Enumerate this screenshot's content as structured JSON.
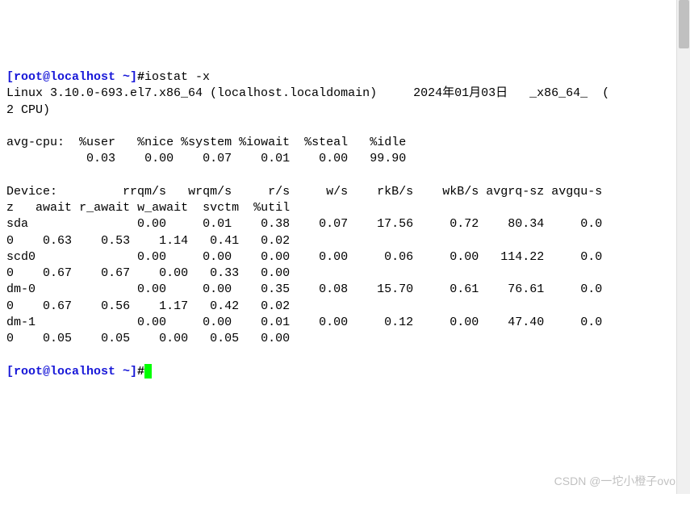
{
  "prompt1": {
    "user_host": "[root@localhost ~]",
    "hash": "#",
    "command": "iostat -x"
  },
  "header": {
    "kernel": "Linux 3.10.0-693.el7.x86_64 (localhost.localdomain)",
    "date": "2024年01月03日",
    "arch": "_x86_64_",
    "cpu_wrap_open": "(",
    "cpu_wrap_close": "2 CPU)"
  },
  "avg_cpu": {
    "label": "avg-cpu:",
    "cols": {
      "user": "%user",
      "nice": "%nice",
      "system": "%system",
      "iowait": "%iowait",
      "steal": "%steal",
      "idle": "%idle"
    },
    "vals": {
      "user": "0.03",
      "nice": "0.00",
      "system": "0.07",
      "iowait": "0.01",
      "steal": "0.00",
      "idle": "99.90"
    }
  },
  "dev_header": {
    "label": "Device:",
    "l1": {
      "rrqm": "rrqm/s",
      "wrqm": "wrqm/s",
      "rs": "r/s",
      "ws": "w/s",
      "rkb": "rkB/s",
      "wkb": "wkB/s",
      "avgrq": "avgrq-sz",
      "avgqu": "avgqu-s"
    },
    "l2": {
      "z": "z",
      "await": "await",
      "r_await": "r_await",
      "w_await": "w_await",
      "svctm": "svctm",
      "util": "%util"
    }
  },
  "devices": {
    "sda": {
      "name": "sda",
      "l1": {
        "rrqm": "0.00",
        "wrqm": "0.01",
        "rs": "0.38",
        "ws": "0.07",
        "rkb": "17.56",
        "wkb": "0.72",
        "avgrq": "80.34",
        "avgqu": "0.0"
      },
      "l2": {
        "z": "0",
        "await": "0.63",
        "r_await": "0.53",
        "w_await": "1.14",
        "svctm": "0.41",
        "util": "0.02"
      }
    },
    "scd0": {
      "name": "scd0",
      "l1": {
        "rrqm": "0.00",
        "wrqm": "0.00",
        "rs": "0.00",
        "ws": "0.00",
        "rkb": "0.06",
        "wkb": "0.00",
        "avgrq": "114.22",
        "avgqu": "0.0"
      },
      "l2": {
        "z": "0",
        "await": "0.67",
        "r_await": "0.67",
        "w_await": "0.00",
        "svctm": "0.33",
        "util": "0.00"
      }
    },
    "dm0": {
      "name": "dm-0",
      "l1": {
        "rrqm": "0.00",
        "wrqm": "0.00",
        "rs": "0.35",
        "ws": "0.08",
        "rkb": "15.70",
        "wkb": "0.61",
        "avgrq": "76.61",
        "avgqu": "0.0"
      },
      "l2": {
        "z": "0",
        "await": "0.67",
        "r_await": "0.56",
        "w_await": "1.17",
        "svctm": "0.42",
        "util": "0.02"
      }
    },
    "dm1": {
      "name": "dm-1",
      "l1": {
        "rrqm": "0.00",
        "wrqm": "0.00",
        "rs": "0.01",
        "ws": "0.00",
        "rkb": "0.12",
        "wkb": "0.00",
        "avgrq": "47.40",
        "avgqu": "0.0"
      },
      "l2": {
        "z": "0",
        "await": "0.05",
        "r_await": "0.05",
        "w_await": "0.00",
        "svctm": "0.05",
        "util": "0.00"
      }
    }
  },
  "prompt2": {
    "user_host": "[root@localhost ~]",
    "hash": "#"
  },
  "watermark": "CSDN @一坨小橙子ovo"
}
